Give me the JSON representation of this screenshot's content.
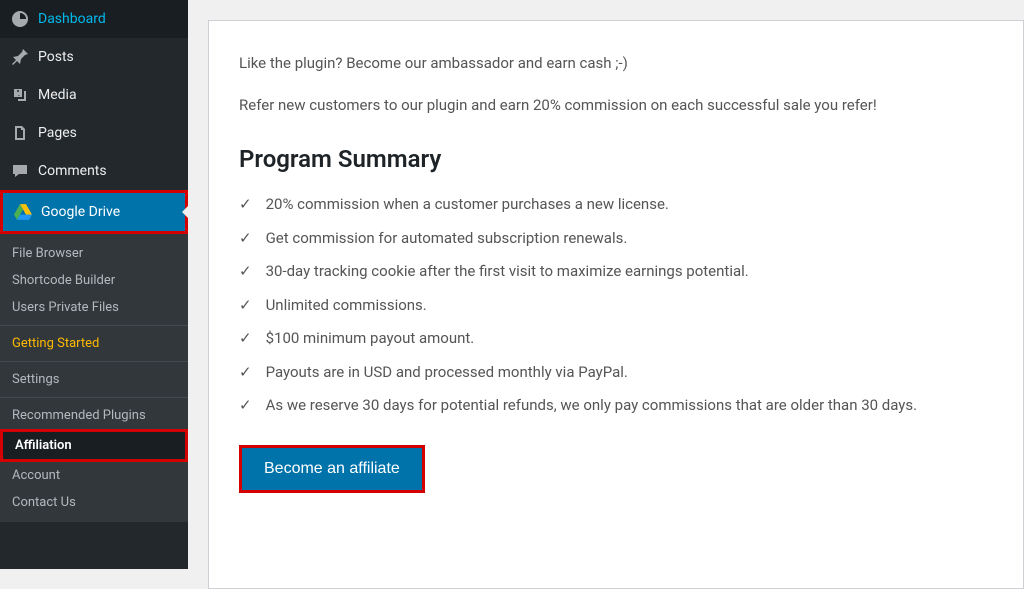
{
  "sidebar": {
    "main_items": [
      {
        "label": "Dashboard",
        "icon": "dashboard"
      },
      {
        "label": "Posts",
        "icon": "pin"
      },
      {
        "label": "Media",
        "icon": "media"
      },
      {
        "label": "Pages",
        "icon": "pages"
      },
      {
        "label": "Comments",
        "icon": "comments"
      }
    ],
    "active_item": {
      "label": "Google Drive",
      "icon": "gdrive"
    },
    "submenu": [
      {
        "label": "File Browser"
      },
      {
        "label": "Shortcode Builder"
      },
      {
        "label": "Users Private Files"
      },
      {
        "label": "Getting Started",
        "highlighted": true
      },
      {
        "label": "Settings"
      },
      {
        "label": "Recommended Plugins"
      },
      {
        "label": "Affiliation",
        "current": true
      },
      {
        "label": "Account"
      },
      {
        "label": "Contact Us"
      }
    ]
  },
  "content": {
    "intro_line1": "Like the plugin? Become our ambassador and earn cash ;-)",
    "intro_line2": "Refer new customers to our plugin and earn 20% commission on each successful sale you refer!",
    "section_title": "Program Summary",
    "checklist": [
      "20% commission when a customer purchases a new license.",
      "Get commission for automated subscription renewals.",
      "30-day tracking cookie after the first visit to maximize earnings potential.",
      "Unlimited commissions.",
      "$100 minimum payout amount.",
      "Payouts are in USD and processed monthly via PayPal.",
      "As we reserve 30 days for potential refunds, we only pay commissions that are older than 30 days."
    ],
    "cta_label": "Become an affiliate"
  }
}
